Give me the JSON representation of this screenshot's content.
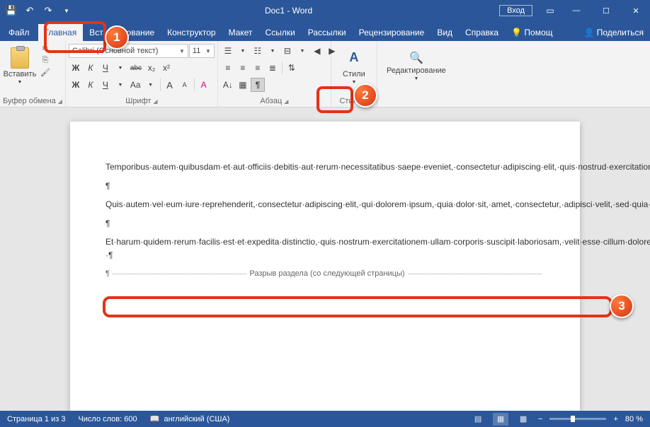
{
  "title": "Doc1  -  Word",
  "signin": "Вход",
  "tabs": {
    "file": "Файл",
    "home": "Главная",
    "insert": "Вст",
    "draw": "исование",
    "design": "Конструктор",
    "layout": "Макет",
    "references": "Ссылки",
    "mailings": "Рассылки",
    "review": "Рецензирование",
    "view": "Вид",
    "help": "Справка",
    "tellme": "Помощ",
    "share": "Поделиться"
  },
  "ribbon": {
    "clipboard": {
      "label": "Буфер обмена",
      "paste": "Вставить"
    },
    "font": {
      "label": "Шрифт",
      "name": "Calibri (Основной текст)",
      "size": "11",
      "bold": "Ж",
      "italic": "К",
      "underline": "Ч",
      "strike": "abc",
      "sub": "x₂",
      "sup": "x²",
      "bold2": "Ж",
      "italic2": "К",
      "underline2": "Ч",
      "caps": "Aa",
      "sizeup": "A",
      "sizedn": "A",
      "clear": "A"
    },
    "paragraph": {
      "label": "Абзац"
    },
    "styles": {
      "label": "Стили",
      "btn": "Стили"
    },
    "editing": {
      "label": "Редактирование"
    }
  },
  "doc": {
    "p1": "Temporibus·autem·quibusdam·et·aut·officiis·debitis·aut·rerum·necessitatibus·saepe·eveniet,·consectetur·adipiscing·elit,·quis·nostrud·exercitation·ullamco·laboris·nisi·ut·aliquip·ex·ea·commodo·consequat.·¶",
    "p2": "¶",
    "p3": "Quis·autem·vel·eum·iure·reprehenderit,·consectetur·adipiscing·elit,·qui·dolorem·ipsum,·quia·dolor·sit,·amet,·consectetur,·adipisci·velit,·sed·quia·non·numquam·eius·modi·tempora·incidunt,·ut·labore·et·dolore·magnam·aliquam·quaerat·voluptatem.¶",
    "p4": "¶",
    "p5": "Et·harum·quidem·rerum·facilis·est·et·expedita·distinctio,·quis·nostrum·exercitationem·ullam·corporis·suscipit·laboriosam,·velit·esse·cillum·dolore·eu·fugiat·nulla·pariatur!·¶",
    "break_prefix": "¶",
    "break_text": "Разрыв раздела (со следующей страницы)"
  },
  "status": {
    "page": "Страница 1 из 3",
    "words": "Число слов: 600",
    "lang": "английский (США)",
    "zoom": "80 %"
  },
  "callouts": {
    "n1": "1",
    "n2": "2",
    "n3": "3"
  }
}
